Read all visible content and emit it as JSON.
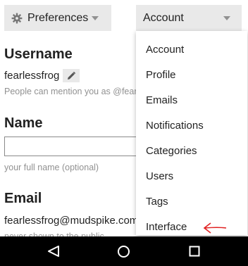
{
  "topbar": {
    "preferences_label": "Preferences",
    "account_label": "Account",
    "icons": {
      "preferences": "gear-icon",
      "dropdown": "chevron-down-icon"
    }
  },
  "username": {
    "heading": "Username",
    "value": "fearlessfrog",
    "hint": "People can mention you as @fearlessfrog",
    "edit_icon": "pencil-icon"
  },
  "name": {
    "heading": "Name",
    "value": "",
    "hint": "your full name (optional)"
  },
  "email": {
    "heading": "Email",
    "value": "fearlessfrog@mudspike.com",
    "hint": "never shown to the public"
  },
  "dropdown": {
    "items": [
      {
        "label": "Account"
      },
      {
        "label": "Profile"
      },
      {
        "label": "Emails"
      },
      {
        "label": "Notifications"
      },
      {
        "label": "Categories"
      },
      {
        "label": "Users"
      },
      {
        "label": "Tags"
      },
      {
        "label": "Interface"
      }
    ]
  },
  "navbar": {
    "icons": [
      "back-icon",
      "home-icon",
      "recents-icon"
    ]
  },
  "colors": {
    "button_bg": "#e9e9e9",
    "hint_text": "#919191",
    "annotation_arrow": "#e02020",
    "navbar_bg": "#000000"
  }
}
